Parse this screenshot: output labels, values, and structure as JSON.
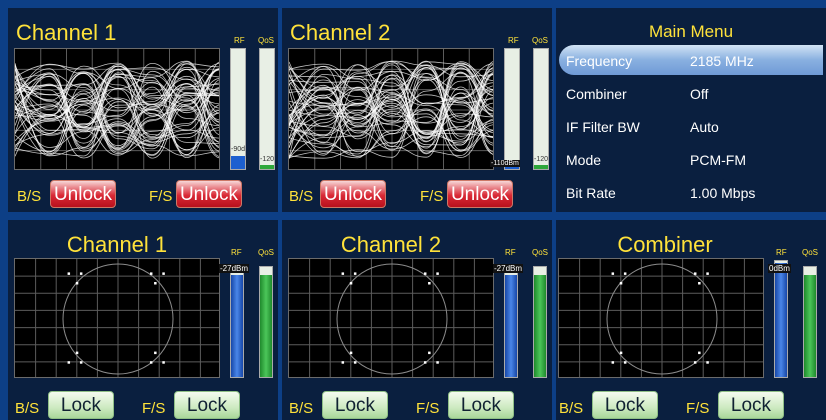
{
  "colors": {
    "accent_yellow": "#ffe23a",
    "panel_bg": "#0a1f3f",
    "page_bg": "#0d3f86",
    "unlock_red": "#d92a36",
    "lock_green": "#bfe3b0",
    "rf_blue": "#1c5fd0",
    "qos_green": "#2ea83a"
  },
  "top_channels": [
    {
      "title": "Channel 1",
      "rf_label": "RF",
      "qos_label": "QoS",
      "rf_value": "-90dBm",
      "qos_value": "-120",
      "rf_level": 0.11,
      "qos_level": 0.03,
      "bs_label": "B/S",
      "bs_status": "Unlock",
      "fs_label": "F/S",
      "fs_status": "Unlock"
    },
    {
      "title": "Channel 2",
      "rf_label": "RF",
      "qos_label": "QoS",
      "rf_value": "-110dBm",
      "qos_value": "-120",
      "rf_level": 0.03,
      "qos_level": 0.03,
      "bs_label": "B/S",
      "bs_status": "Unlock",
      "fs_label": "F/S",
      "fs_status": "Unlock"
    }
  ],
  "main_menu": {
    "title": "Main Menu",
    "items": [
      {
        "label": "Frequency",
        "value": "2185 MHz",
        "selected": true
      },
      {
        "label": "Combiner",
        "value": "Off",
        "selected": false
      },
      {
        "label": "IF Filter BW",
        "value": "Auto",
        "selected": false
      },
      {
        "label": "Mode",
        "value": "PCM-FM",
        "selected": false
      },
      {
        "label": "Bit Rate",
        "value": "1.00 Mbps",
        "selected": false
      }
    ]
  },
  "bottom_panels": [
    {
      "title": "Channel 1",
      "rf_label": "RF",
      "qos_label": "QoS",
      "rf_value": "-27dBm",
      "rf_level": 0.93,
      "qos_level": 0.93,
      "bs_label": "B/S",
      "bs_status": "Lock",
      "fs_label": "F/S",
      "fs_status": "Lock"
    },
    {
      "title": "Channel 2",
      "rf_label": "RF",
      "qos_label": "QoS",
      "rf_value": "-27dBm",
      "rf_level": 0.93,
      "qos_level": 0.93,
      "bs_label": "B/S",
      "bs_status": "Lock",
      "fs_label": "F/S",
      "fs_status": "Lock"
    },
    {
      "title": "Combiner",
      "rf_label": "RF",
      "qos_label": "QoS",
      "rf_value": "0dBm",
      "rf_level": 0.98,
      "qos_level": 0.93,
      "bs_label": "B/S",
      "bs_status": "Lock",
      "fs_label": "F/S",
      "fs_status": "Lock"
    }
  ]
}
